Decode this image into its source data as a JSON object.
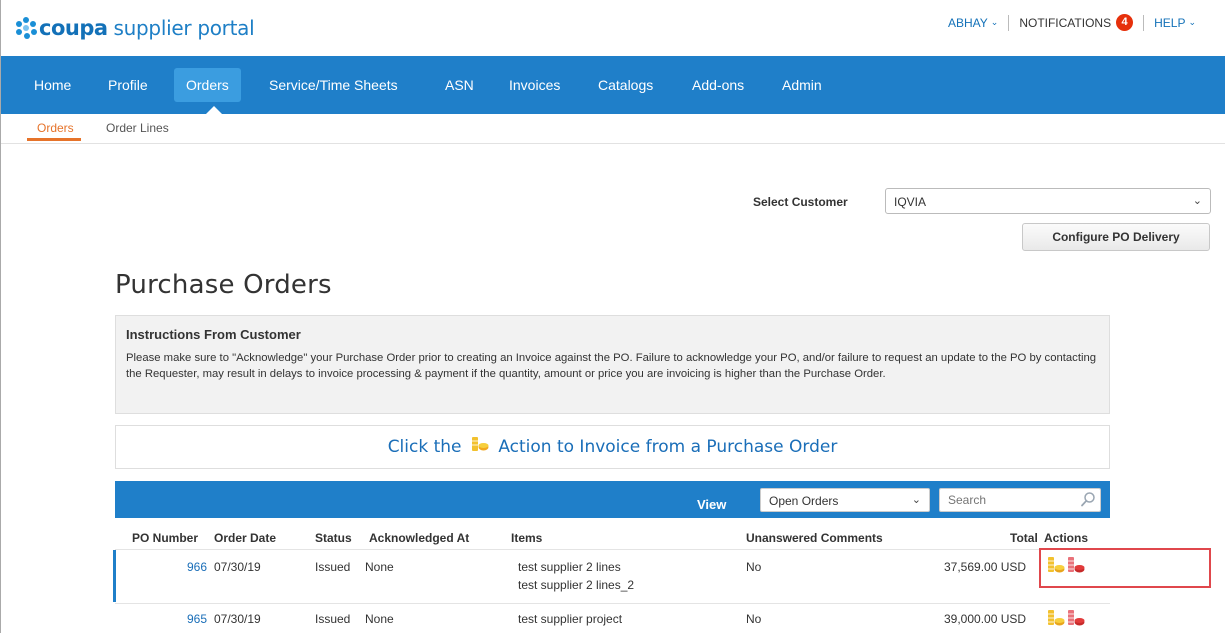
{
  "header": {
    "logo_word": "coupa",
    "logo_sub": "supplier portal",
    "user": "ABHAY",
    "notifications_label": "NOTIFICATIONS",
    "notifications_count": "4",
    "help": "HELP"
  },
  "nav": {
    "items": [
      "Home",
      "Profile",
      "Orders",
      "Service/Time Sheets",
      "ASN",
      "Invoices",
      "Catalogs",
      "Add-ons",
      "Admin"
    ],
    "active": "Orders"
  },
  "subnav": {
    "items": [
      "Orders",
      "Order Lines"
    ],
    "active": "Orders"
  },
  "customer": {
    "label": "Select Customer",
    "selected": "IQVIA",
    "configure_button": "Configure PO Delivery"
  },
  "page_title": "Purchase Orders",
  "instructions": {
    "title": "Instructions From Customer",
    "body": "Please make sure to \"Acknowledge\" your Purchase Order prior to creating an Invoice against the PO. Failure to acknowledge your PO, and/or failure to request an update to the PO by contacting the Requester, may result in delays to invoice processing & payment if the quantity, amount or price you are invoicing is higher than the Purchase Order."
  },
  "banner": {
    "before": "Click the",
    "after": "Action to Invoice from a Purchase Order"
  },
  "table": {
    "view_label": "View",
    "view_selected": "Open Orders",
    "search_placeholder": "Search",
    "columns": [
      "PO Number",
      "Order Date",
      "Status",
      "Acknowledged At",
      "Items",
      "Unanswered Comments",
      "Total",
      "Actions"
    ],
    "rows": [
      {
        "po_number": "966",
        "order_date": "07/30/19",
        "status": "Issued",
        "acknowledged_at": "None",
        "items": [
          "test supplier 2 lines",
          "test supplier 2 lines_2"
        ],
        "comments": "No",
        "total": "37,569.00 USD"
      },
      {
        "po_number": "965",
        "order_date": "07/30/19",
        "status": "Issued",
        "acknowledged_at": "None",
        "items": [
          "test supplier project"
        ],
        "comments": "No",
        "total": "39,000.00 USD"
      }
    ]
  },
  "colors": {
    "brand_blue": "#1f7fc9",
    "active_tab": "#3b9de0",
    "link": "#1a6eb8",
    "badge_red": "#e6300b",
    "subnav_orange": "#e6732a",
    "coin_gold": "#f2c12e",
    "coin_red": "#e23b3b",
    "highlight_red": "#e0474c"
  },
  "icons": {
    "invoice_action": "gold-coins-icon",
    "credit_action": "red-coins-icon",
    "search": "search-icon",
    "logo": "coupa-logo-icon"
  }
}
